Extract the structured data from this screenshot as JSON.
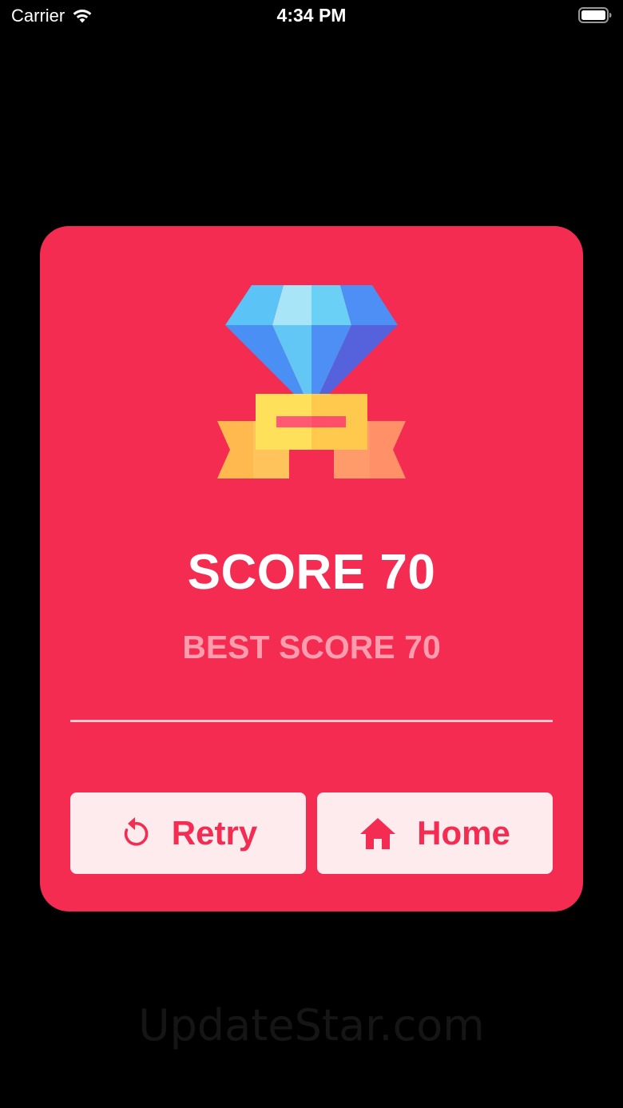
{
  "status_bar": {
    "carrier": "Carrier",
    "time": "4:34 PM",
    "icons": [
      "wifi-icon",
      "battery-icon"
    ]
  },
  "result_card": {
    "illustration": "diamond-award-icon",
    "score_label": "SCORE 70",
    "best_score_label": "BEST SCORE 70",
    "buttons": {
      "retry": {
        "label": "Retry",
        "icon": "retry-icon"
      },
      "home": {
        "label": "Home",
        "icon": "home-icon"
      }
    }
  },
  "watermark": "UpdateStar.com",
  "colors": {
    "background": "#000000",
    "card": "#f42c51",
    "button_bg": "#fdebee",
    "accent": "#f42c51",
    "best_score_text": "#ff9cae"
  }
}
